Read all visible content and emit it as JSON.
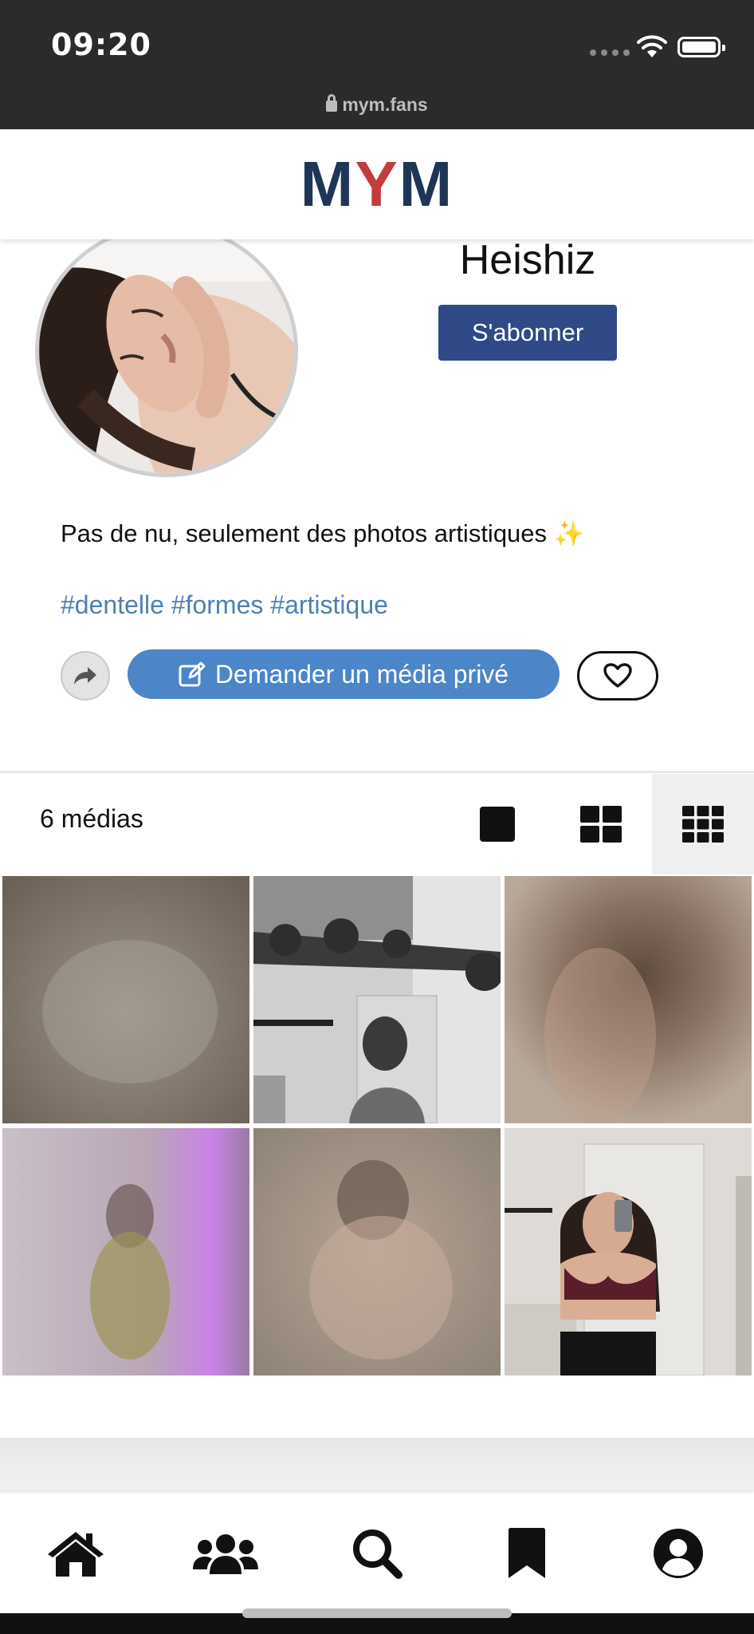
{
  "status_bar": {
    "time": "09:20",
    "url": "mym.fans"
  },
  "header": {
    "logo_parts": [
      "M",
      "Y",
      "M"
    ],
    "logo_colors": {
      "m": "#1f3556",
      "y": "#c43b3b"
    }
  },
  "profile": {
    "username": "Heishiz",
    "subscribe_label": "S'abonner",
    "bio": "Pas de nu, seulement des photos artistiques ✨",
    "hashtags": "#dentelle #formes #artistique",
    "request_label": "Demander un média privé"
  },
  "media": {
    "count_label": "6 médias",
    "views": [
      "single-view-icon",
      "grid-2-icon",
      "grid-3-icon"
    ],
    "active_view": "grid-3-icon"
  },
  "bottom_nav": {
    "items": [
      "home-icon",
      "users-icon",
      "search-icon",
      "bookmark-icon",
      "profile-icon"
    ]
  },
  "colors": {
    "accent": "#4a86c8",
    "subscribe": "#2f4a87",
    "hashtag": "#4d7fb3"
  }
}
